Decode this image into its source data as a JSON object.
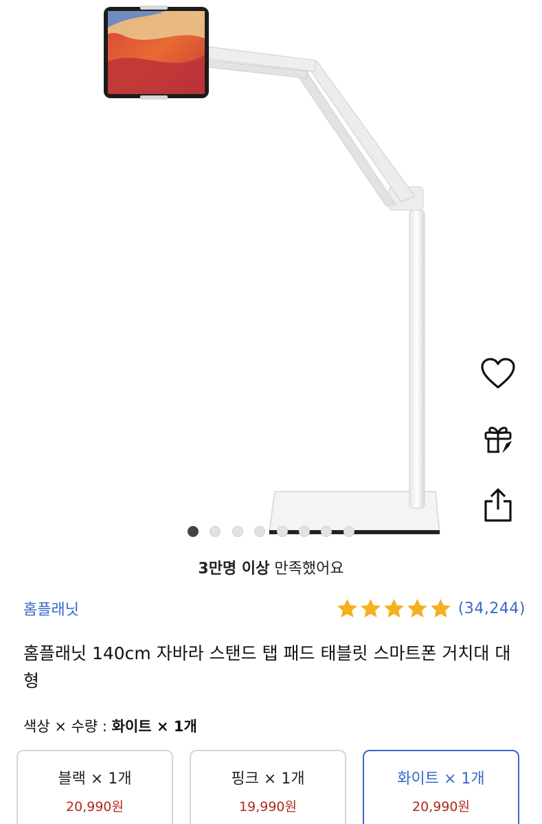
{
  "product": {
    "brand": "홈플래닛",
    "title": "홈플래닛 140cm 자바라 스탠드 탭 패드 태블릿 스마트폰 거치대 대형",
    "rating": 5,
    "review_count": "(34,244)"
  },
  "gallery": {
    "total_images": 8,
    "current_index": 1
  },
  "satisfaction": {
    "highlight": "3만명 이상",
    "text": "만족했어요"
  },
  "side_actions": {
    "icons": [
      "heart-icon",
      "gift-icon",
      "share-icon"
    ]
  },
  "option_summary": {
    "label": "색상 × 수량 :",
    "selected": "화이트 × 1개"
  },
  "options": [
    {
      "name": "블랙 × 1개",
      "price": "20,990원",
      "selected": false
    },
    {
      "name": "핑크 × 1개",
      "price": "19,990원",
      "selected": false
    },
    {
      "name": "화이트 × 1개",
      "price": "20,990원",
      "selected": true
    }
  ],
  "colors": {
    "link_blue": "#3568c9",
    "star_yellow": "#f5b01e",
    "price_red": "#b0261c"
  }
}
